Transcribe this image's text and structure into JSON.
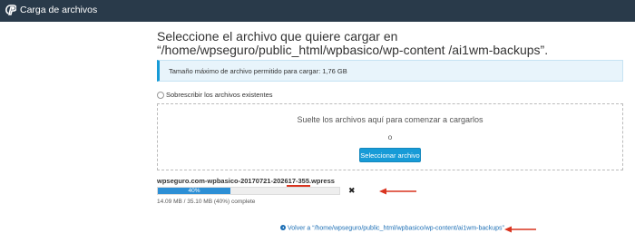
{
  "header": {
    "title": "Carga de archivos"
  },
  "main": {
    "heading": "Seleccione el archivo que quiere cargar en “/home/wpseguro/public_html/wpbasico/wp-content /ai1wm-backups”.",
    "max_size_notice": "Tamaño máximo de archivo permitido para cargar: 1,76 GB",
    "overwrite_label": "Sobrescribir los archivos existentes",
    "dropzone": {
      "instruction": "Suelte los archivos aquí para comenzar a cargarlos",
      "or_text": "o",
      "select_button": "Seleccionar archivo"
    },
    "upload": {
      "file_name": "wpseguro.com-wpbasico-20170721-202617-355.wpress",
      "progress_label": "40%",
      "progress_fraction": 0.4,
      "size_status": "14.09 MB / 35.10 MB (40%) complete",
      "cancel_icon": "close-icon"
    },
    "back_link": "Volver a “/home/wpseguro/public_html/wpbasico/wp-content/ai1wm-backups”"
  },
  "colors": {
    "topbar": "#293a4a",
    "accent": "#179bd7",
    "progress": "#2d8fd5",
    "annotation": "#d9341f",
    "link": "#1d6fb5"
  }
}
